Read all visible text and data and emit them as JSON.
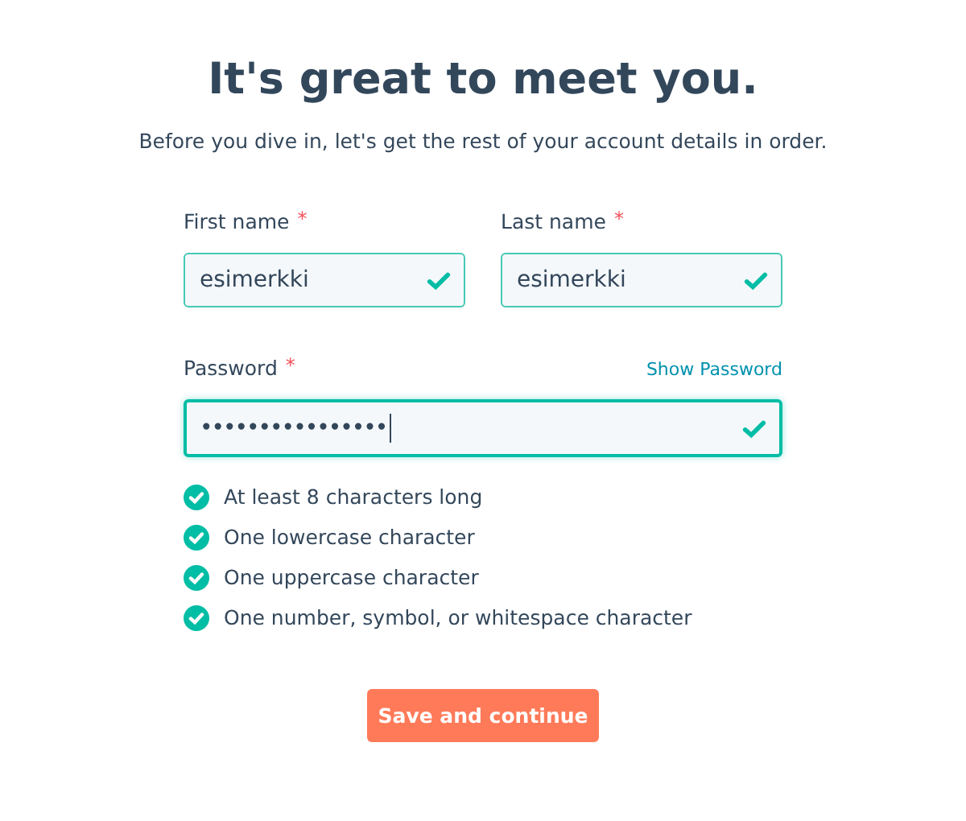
{
  "heading": "It's great to meet you.",
  "subtitle": "Before you dive in, let's get the rest of your account details in order.",
  "name_fields": [
    {
      "label": "First name",
      "required_mark": "*",
      "value": "esimerkki",
      "valid": true,
      "focused": false
    },
    {
      "label": "Last name",
      "required_mark": "*",
      "value": "esimerkki",
      "valid": true,
      "focused": false
    }
  ],
  "password_field": {
    "label": "Password",
    "required_mark": "*",
    "toggle_link": "Show Password",
    "value": "••••••••••••••••",
    "valid": true,
    "focused": true
  },
  "requirements": [
    {
      "text": "At least 8 characters long",
      "met": true
    },
    {
      "text": "One lowercase character",
      "met": true
    },
    {
      "text": "One uppercase character",
      "met": true
    },
    {
      "text": "One number, symbol, or whitespace character",
      "met": true
    }
  ],
  "submit_button": "Save and continue"
}
